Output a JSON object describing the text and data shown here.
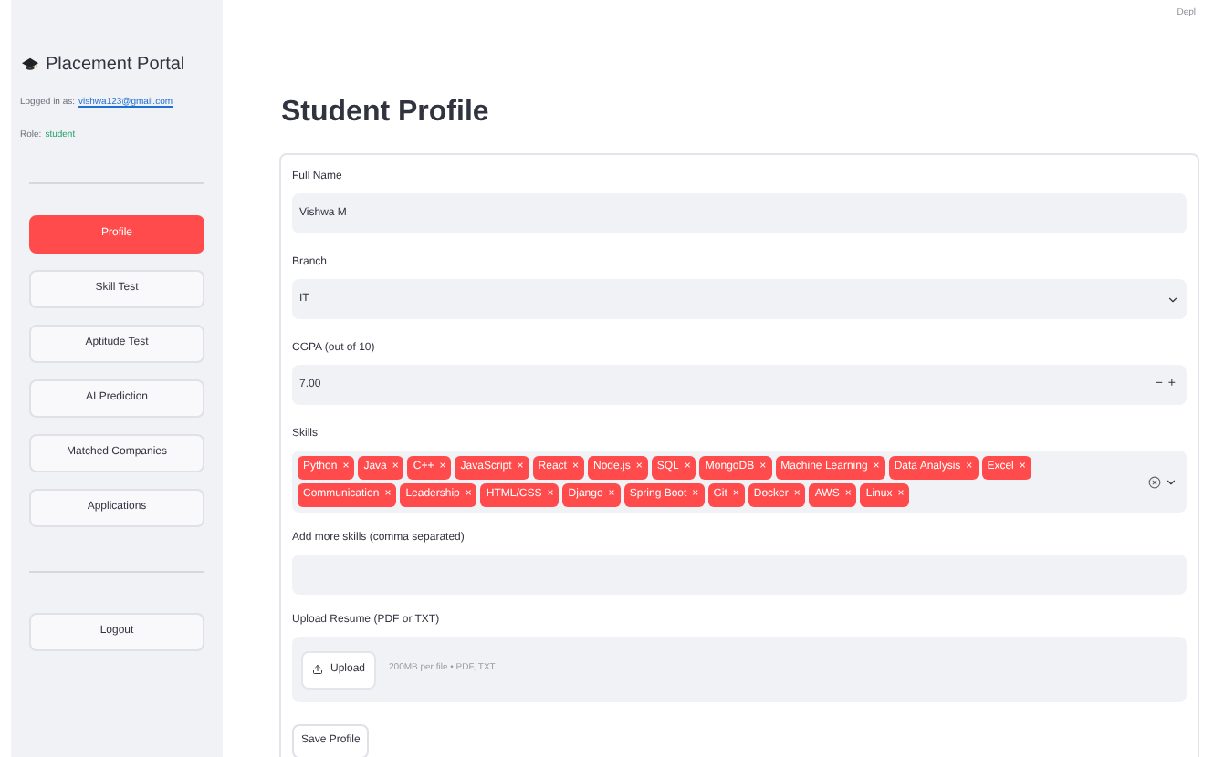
{
  "top_bar": {
    "deploy": "Depl"
  },
  "sidebar": {
    "title": "Placement Portal",
    "logged_in_label": "Logged in as:",
    "email": "vishwa123@gmail.com",
    "role_label": "Role:",
    "role": "student",
    "items": [
      {
        "label": "Profile",
        "selected": true
      },
      {
        "label": "Skill Test",
        "selected": false
      },
      {
        "label": "Aptitude Test",
        "selected": false
      },
      {
        "label": "AI Prediction",
        "selected": false
      },
      {
        "label": "Matched Companies",
        "selected": false
      },
      {
        "label": "Applications",
        "selected": false
      }
    ],
    "logout": "Logout"
  },
  "page": {
    "title": "Student Profile"
  },
  "form": {
    "full_name": {
      "label": "Full Name",
      "value": "Vishwa M"
    },
    "branch": {
      "label": "Branch",
      "value": "IT"
    },
    "cgpa": {
      "label": "CGPA (out of 10)",
      "value": "7.00",
      "minus": "−",
      "plus": "+"
    },
    "skills": {
      "label": "Skills",
      "items": [
        "Python",
        "Java",
        "C++",
        "JavaScript",
        "React",
        "Node.js",
        "SQL",
        "MongoDB",
        "Machine Learning",
        "Data Analysis",
        "Excel",
        "Communication",
        "Leadership",
        "HTML/CSS",
        "Django",
        "Spring Boot",
        "Git",
        "Docker",
        "AWS",
        "Linux"
      ],
      "remove": "×"
    },
    "more_skills": {
      "label": "Add more skills (comma separated)"
    },
    "resume": {
      "label": "Upload Resume (PDF or TXT)",
      "button": "Upload",
      "hint": "200MB per file • PDF, TXT"
    },
    "save": "Save Profile"
  }
}
